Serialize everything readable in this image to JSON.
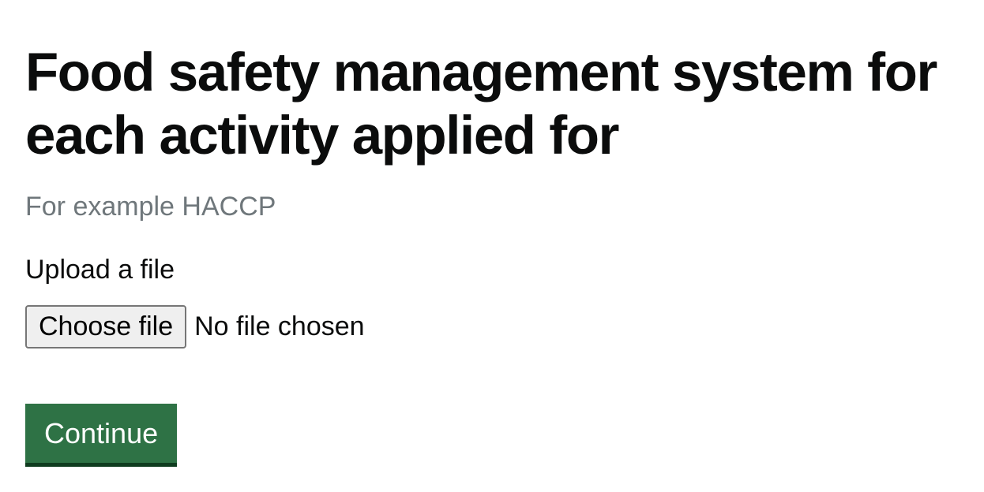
{
  "page": {
    "title_line_1": "Food safety management system for",
    "title_line_2": "each activity applied for",
    "hint": "For example HACCP"
  },
  "upload": {
    "label": "Upload a file",
    "choose_button_label": "Choose file",
    "status": "No file chosen"
  },
  "actions": {
    "continue_label": "Continue"
  },
  "colors": {
    "primary_button": "#2e7245",
    "primary_button_shadow": "#0f3c1f",
    "hint_text": "#6f777b",
    "text": "#0b0c0c"
  }
}
